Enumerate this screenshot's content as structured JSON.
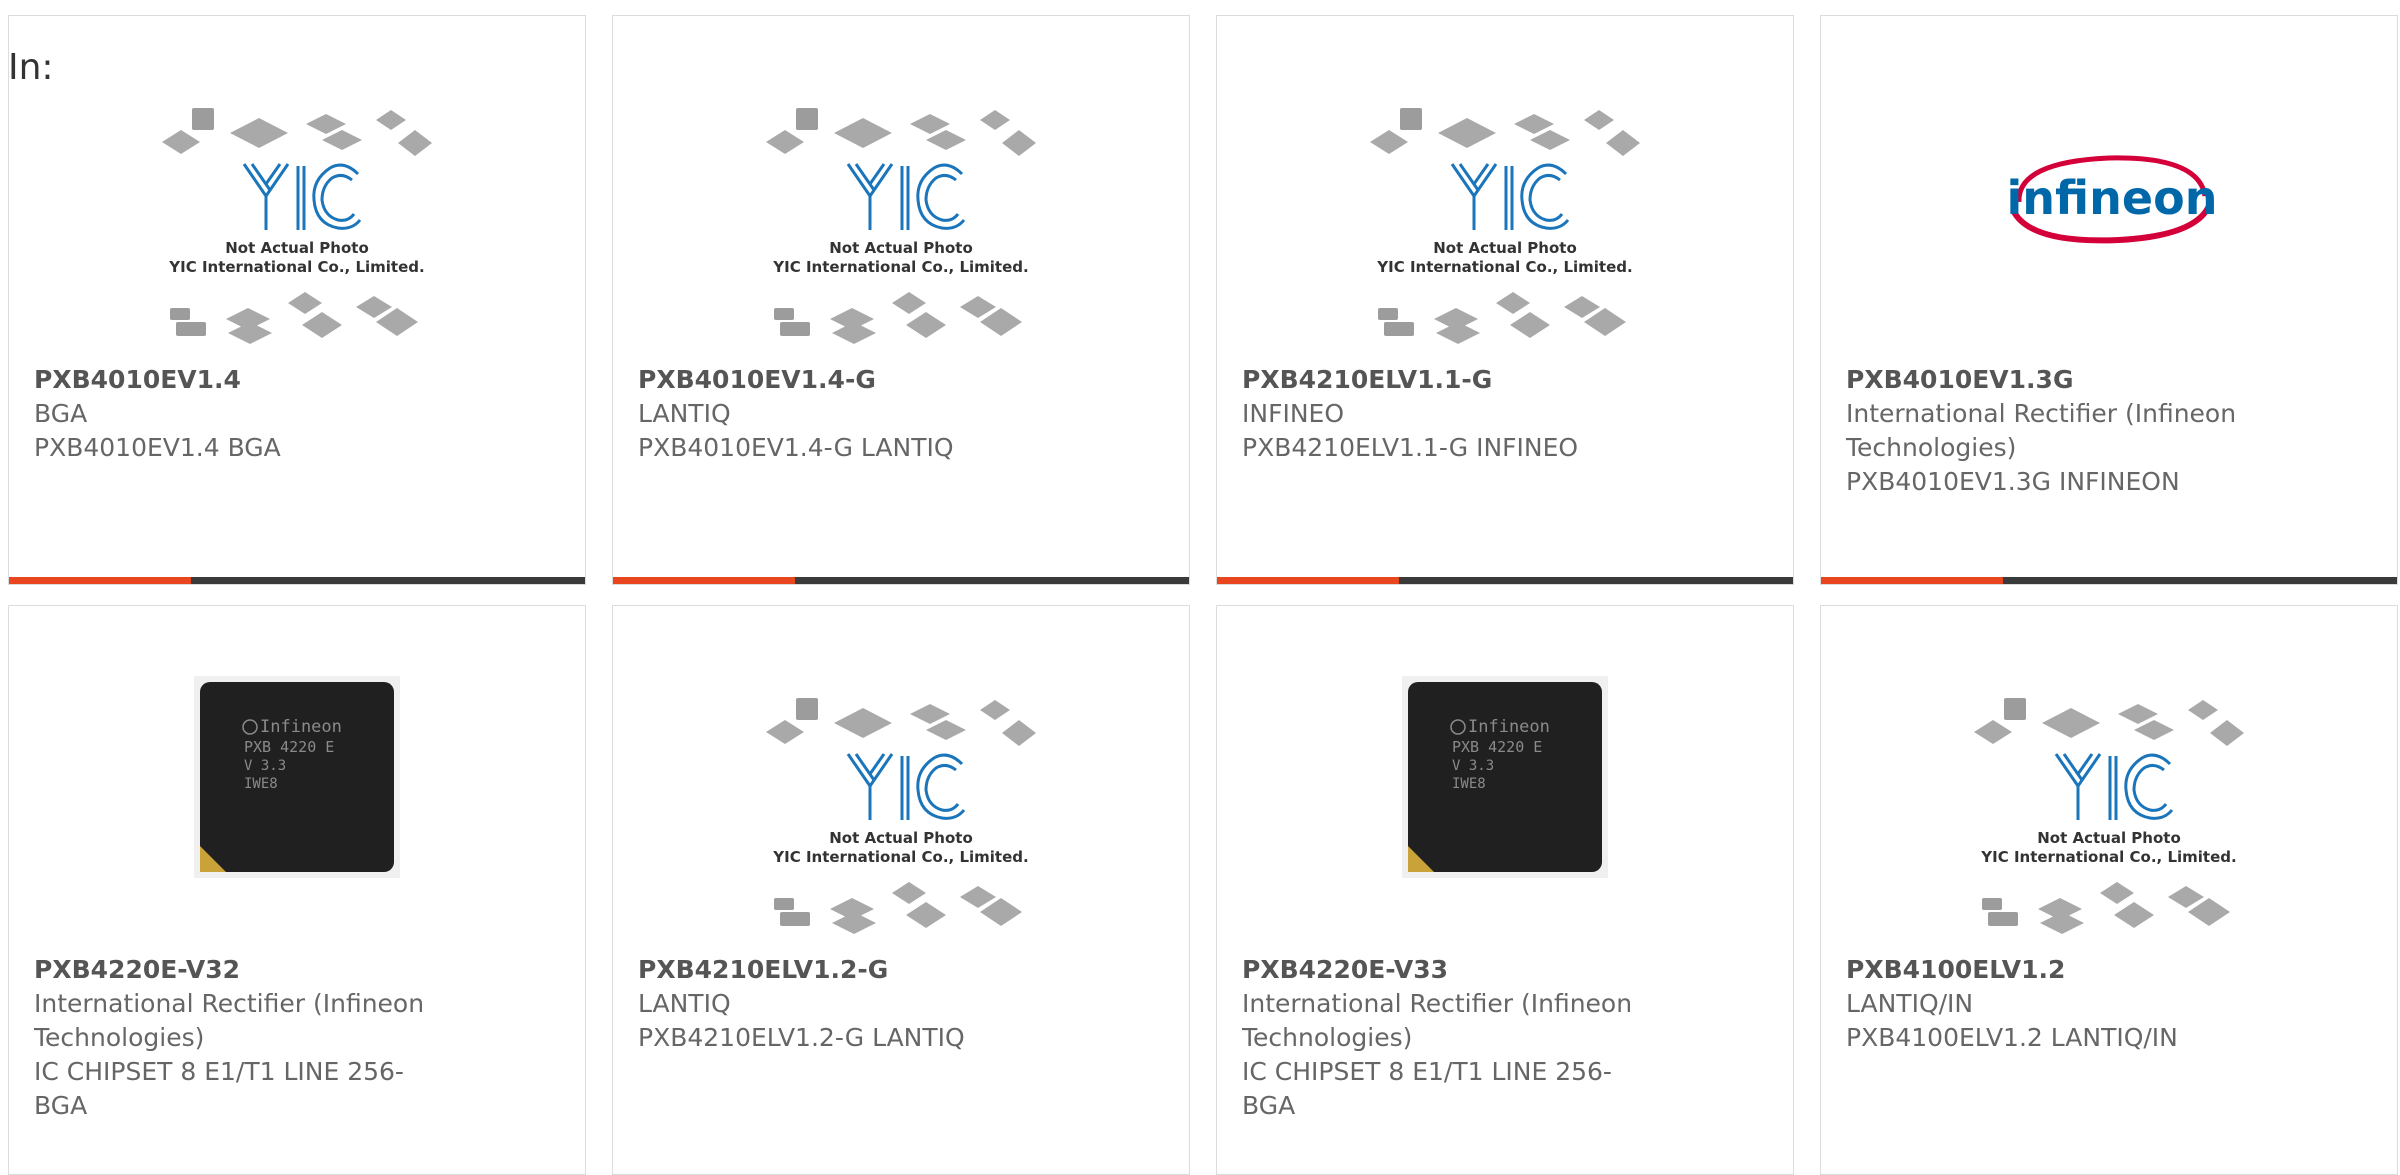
{
  "intro": "In:",
  "colors": {
    "accent": "#e8461e",
    "bar": "#3a3a3a",
    "ic_blue": "#1b75bb",
    "infineon_red": "#d4003a"
  },
  "products": [
    {
      "part": "PXB4010EV1.4",
      "lines": [
        "BGA",
        "PXB4010EV1.4 BGA"
      ],
      "image": "yic-placeholder",
      "placeholder_text": [
        "Not Actual Photo",
        "YIC International Co., Limited."
      ]
    },
    {
      "part": "PXB4010EV1.4-G",
      "lines": [
        "LANTIQ",
        "PXB4010EV1.4-G LANTIQ"
      ],
      "image": "yic-placeholder",
      "placeholder_text": [
        "Not Actual Photo",
        "YIC International Co., Limited."
      ]
    },
    {
      "part": "PXB4210ELV1.1-G",
      "lines": [
        "INFINEO",
        "PXB4210ELV1.1-G INFINEO"
      ],
      "image": "yic-placeholder",
      "placeholder_text": [
        "Not Actual Photo",
        "YIC International Co., Limited."
      ]
    },
    {
      "part": "PXB4010EV1.3G",
      "lines": [
        "International Rectifier (Infineon",
        "Technologies)",
        "PXB4010EV1.3G INFINEON"
      ],
      "image": "infineon-logo",
      "logo_text": "infineon"
    },
    {
      "part": "PXB4220E-V32",
      "lines": [
        "International Rectifier (Infineon",
        "Technologies)",
        "IC CHIPSET 8 E1/T1 LINE 256-",
        "BGA"
      ],
      "image": "chip-photo",
      "chip_text": [
        "Infineon",
        "PXB 4220 E",
        "V 3.3",
        "IWE8"
      ]
    },
    {
      "part": "PXB4210ELV1.2-G",
      "lines": [
        "LANTIQ",
        "PXB4210ELV1.2-G LANTIQ"
      ],
      "image": "yic-placeholder",
      "placeholder_text": [
        "Not Actual Photo",
        "YIC International Co., Limited."
      ]
    },
    {
      "part": "PXB4220E-V33",
      "lines": [
        "International Rectifier (Infineon",
        "Technologies)",
        "IC CHIPSET 8 E1/T1 LINE 256-",
        "BGA"
      ],
      "image": "chip-photo",
      "chip_text": [
        "Infineon",
        "PXB 4220 E",
        "V 3.3",
        "IWE8"
      ]
    },
    {
      "part": "PXB4100ELV1.2",
      "lines": [
        "LANTIQ/IN",
        "PXB4100ELV1.2 LANTIQ/IN"
      ],
      "image": "yic-placeholder",
      "placeholder_text": [
        "Not Actual Photo",
        "YIC International Co., Limited."
      ]
    }
  ]
}
